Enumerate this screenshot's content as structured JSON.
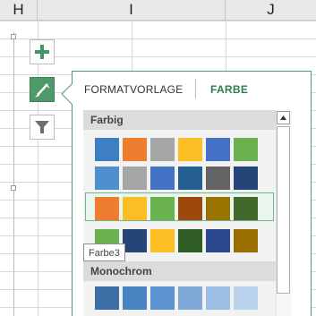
{
  "columns": [
    "H",
    "I",
    "J"
  ],
  "chart_buttons": {
    "add": "plus-icon",
    "style": "paintbrush-icon",
    "filter": "filter-icon"
  },
  "pane": {
    "tab_style": "FORMATVORLAGE",
    "tab_color": "FARBE",
    "active_tab": "FARBE",
    "groups": {
      "colorful_label": "Farbig",
      "monochrome_label": "Monochrom"
    },
    "colorful_rows": [
      [
        "#3d7fc1",
        "#ee7d2f",
        "#a5a5a5",
        "#fbbf24",
        "#4572c4",
        "#6ab150"
      ],
      [
        "#4f8fcd",
        "#a5a5a5",
        "#4472c4",
        "#255e91",
        "#636363",
        "#264478"
      ],
      [
        "#ee7d2f",
        "#fbbf24",
        "#6ab150",
        "#9e480e",
        "#997300",
        "#43682b"
      ],
      [
        "#6ab150",
        "#264478",
        "#fbbf24",
        "#2f5d23",
        "#2a4a8d",
        "#996f00"
      ]
    ],
    "monochrome_rows": [
      [
        "#3d6fa6",
        "#4a83c2",
        "#5b94d1",
        "#7ea9d9",
        "#9dbee3",
        "#bcd3ed"
      ]
    ],
    "selected_row_index": 2,
    "tooltip": "Farbe3"
  },
  "colors": {
    "accent": "#4f9a6a",
    "tab_active": "#2e7d4f"
  }
}
